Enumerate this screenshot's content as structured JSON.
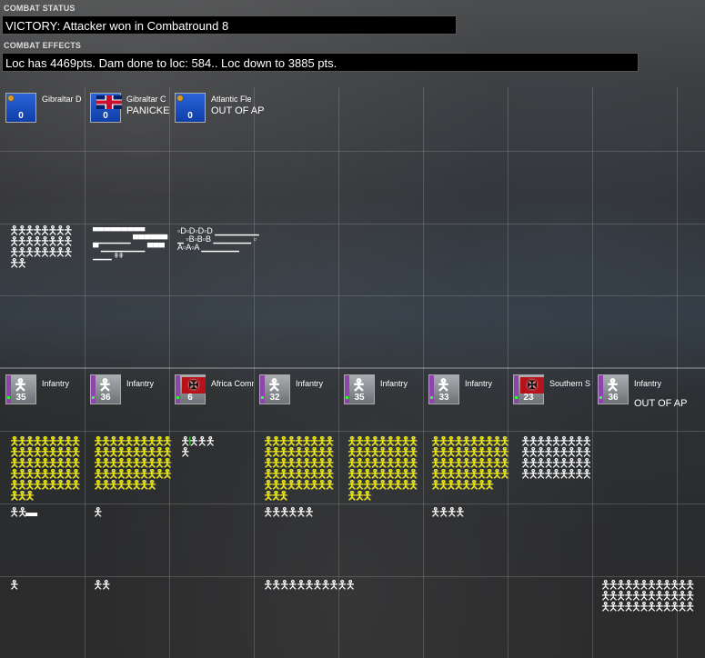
{
  "combat_status": {
    "label": "COMBAT STATUS",
    "text": "VICTORY: Attacker won in Combatround  8"
  },
  "combat_effects": {
    "label": "COMBAT EFFECTS",
    "text": "Loc has  4469pts. Dam done to loc: 584.. Loc down to 3885 pts."
  },
  "defenders": [
    {
      "name": "Gibraltar D",
      "value": "0",
      "status": "",
      "style": "blue",
      "marker": "badge"
    },
    {
      "name": "Gibraltar C",
      "value": "0",
      "status": "PANICKE",
      "style": "blue",
      "marker": "uk-flag"
    },
    {
      "name": "Atlantic Fle",
      "value": "0",
      "status": "OUT OF AP",
      "style": "blue",
      "marker": "badge"
    }
  ],
  "attackers": [
    {
      "name": "Infantry",
      "value": "35",
      "status": "",
      "style": "grey",
      "marker": "soldier-icon"
    },
    {
      "name": "Infantry",
      "value": "36",
      "status": "",
      "style": "grey",
      "marker": "soldier-icon"
    },
    {
      "name": "Africa Comm",
      "value": "6",
      "status": "",
      "style": "grey",
      "marker": "german-flag"
    },
    {
      "name": "Infantry",
      "value": "32",
      "status": "",
      "style": "grey",
      "marker": "soldier-icon"
    },
    {
      "name": "Infantry",
      "value": "35",
      "status": "",
      "style": "grey",
      "marker": "soldier-icon"
    },
    {
      "name": "Infantry",
      "value": "33",
      "status": "",
      "style": "grey",
      "marker": "soldier-icon"
    },
    {
      "name": "Southern S",
      "value": "23",
      "status": "",
      "style": "grey",
      "marker": "german-flag"
    },
    {
      "name": "Infantry",
      "value": "36",
      "status": "OUT OF AP",
      "style": "grey",
      "marker": "soldier-icon"
    }
  ],
  "colors": {
    "defender_counter": "#1f50c4",
    "attacker_counter": "#8d9094",
    "highlight_troops": "#f3f000",
    "background": "#2f3032"
  }
}
